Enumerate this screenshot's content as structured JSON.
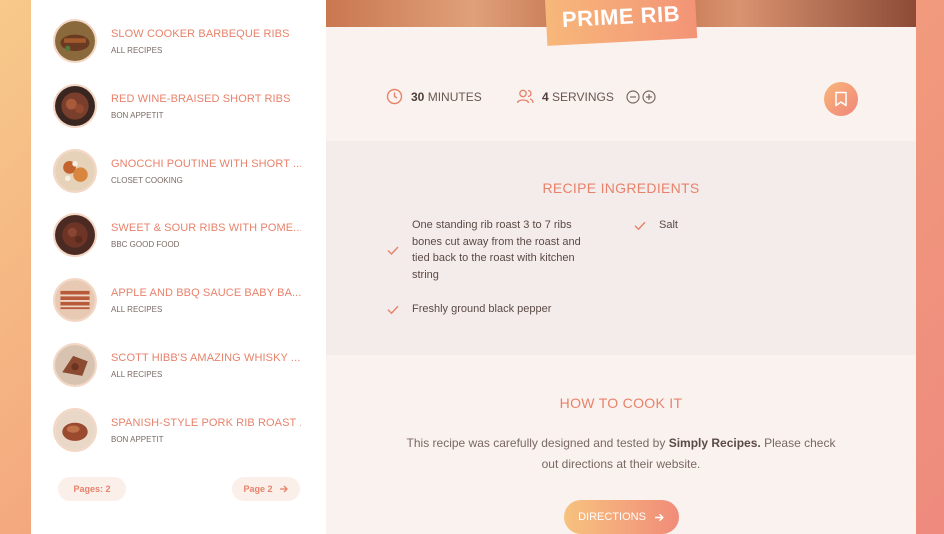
{
  "results": [
    {
      "title": "SLOW COOKER BARBEQUE RIBS",
      "source": "ALL RECIPES"
    },
    {
      "title": "RED WINE-BRAISED SHORT RIBS",
      "source": "BON APPETIT"
    },
    {
      "title": "GNOCCHI POUTINE WITH SHORT ...",
      "source": "CLOSET COOKING"
    },
    {
      "title": "SWEET & SOUR RIBS WITH POME...",
      "source": "BBC GOOD FOOD"
    },
    {
      "title": "APPLE AND BBQ SAUCE BABY BA...",
      "source": "ALL RECIPES"
    },
    {
      "title": "SCOTT HIBB'S AMAZING WHISKY ...",
      "source": "ALL RECIPES"
    },
    {
      "title": "SPANISH-STYLE PORK RIB ROAST ...",
      "source": "BON APPETIT"
    }
  ],
  "pagination": {
    "pages_label": "Pages: 2",
    "next_label": "Page 2"
  },
  "recipe": {
    "title": "PRIME RIB",
    "time_value": "30",
    "time_unit": "MINUTES",
    "servings_value": "4",
    "servings_unit": "SERVINGS"
  },
  "ingredients": {
    "title": "RECIPE INGREDIENTS",
    "items": [
      "One standing rib roast 3 to 7 ribs bones cut away from the roast and tied back to the roast with kitchen string",
      "Salt",
      "Freshly ground black pepper"
    ]
  },
  "howto": {
    "title": "HOW TO COOK IT",
    "text_before": "This recipe was carefully designed and tested by ",
    "source": "Simply Recipes.",
    "text_after": " Please check out directions at their website.",
    "button_label": "DIRECTIONS"
  },
  "colors": {
    "accent": "#e8826b",
    "gradient_start": "#f7b77a",
    "gradient_end": "#f1857a"
  }
}
